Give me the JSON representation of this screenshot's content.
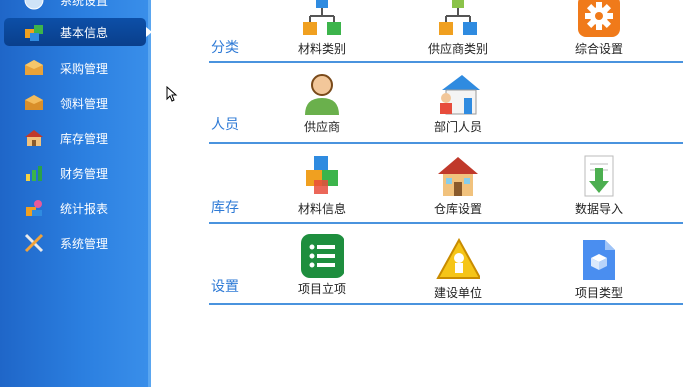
{
  "sidebar": {
    "items": [
      {
        "label": "系统设置",
        "icon": "system-settings-icon"
      },
      {
        "label": "基本信息",
        "icon": "basic-info-icon",
        "active": true
      },
      {
        "label": "采购管理",
        "icon": "purchase-icon"
      },
      {
        "label": "领料管理",
        "icon": "requisition-icon"
      },
      {
        "label": "库存管理",
        "icon": "inventory-icon"
      },
      {
        "label": "财务管理",
        "icon": "finance-icon"
      },
      {
        "label": "统计报表",
        "icon": "report-icon"
      },
      {
        "label": "系统管理",
        "icon": "tools-icon"
      }
    ]
  },
  "sections": [
    {
      "label": "分类",
      "tiles": [
        "材料类别",
        "供应商类别",
        "综合设置"
      ]
    },
    {
      "label": "人员",
      "tiles": [
        "供应商",
        "部门人员"
      ]
    },
    {
      "label": "库存",
      "tiles": [
        "材料信息",
        "仓库设置",
        "数据导入"
      ]
    },
    {
      "label": "设置",
      "tiles": [
        "项目立项",
        "建设单位",
        "项目类型"
      ]
    }
  ],
  "colors": {
    "sidebar": "#2b7fe0",
    "active": "#0c4fa8",
    "accent": "#2e7ad6"
  }
}
